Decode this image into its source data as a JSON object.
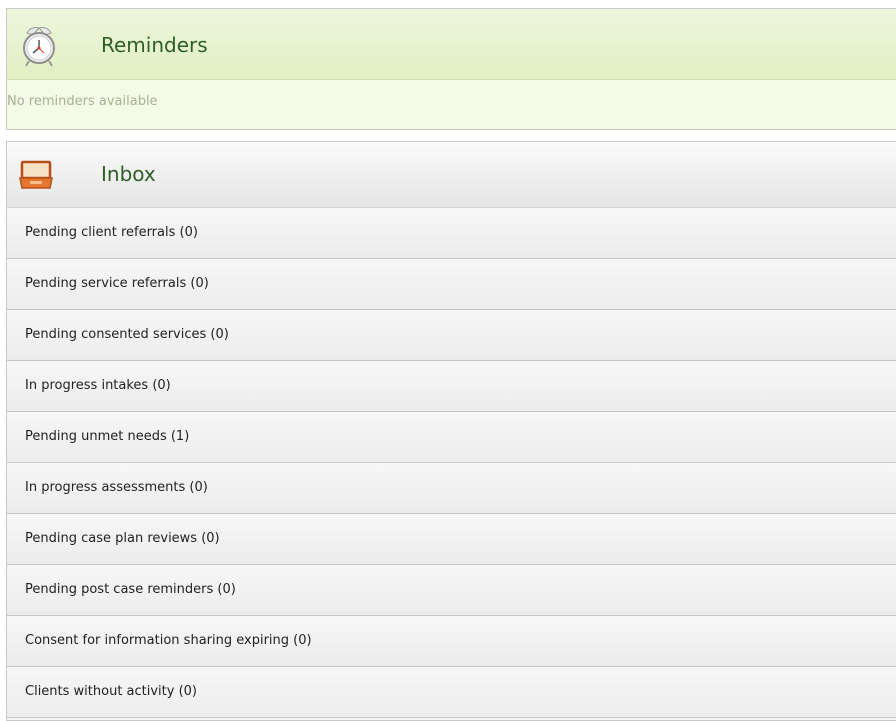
{
  "reminders": {
    "title": "Reminders",
    "icon": "alarm-clock-icon",
    "empty_text": "No reminders available"
  },
  "inbox": {
    "title": "Inbox",
    "icon": "inbox-tray-icon",
    "items": [
      {
        "label": "Pending client referrals (0)"
      },
      {
        "label": "Pending service referrals (0)"
      },
      {
        "label": "Pending consented services (0)"
      },
      {
        "label": "In progress intakes (0)"
      },
      {
        "label": "Pending unmet needs (1)"
      },
      {
        "label": "In progress assessments (0)"
      },
      {
        "label": "Pending case plan reviews (0)"
      },
      {
        "label": "Pending post case reminders (0)"
      },
      {
        "label": "Consent for information sharing expiring (0)"
      },
      {
        "label": "Clients without activity (0)"
      }
    ]
  }
}
